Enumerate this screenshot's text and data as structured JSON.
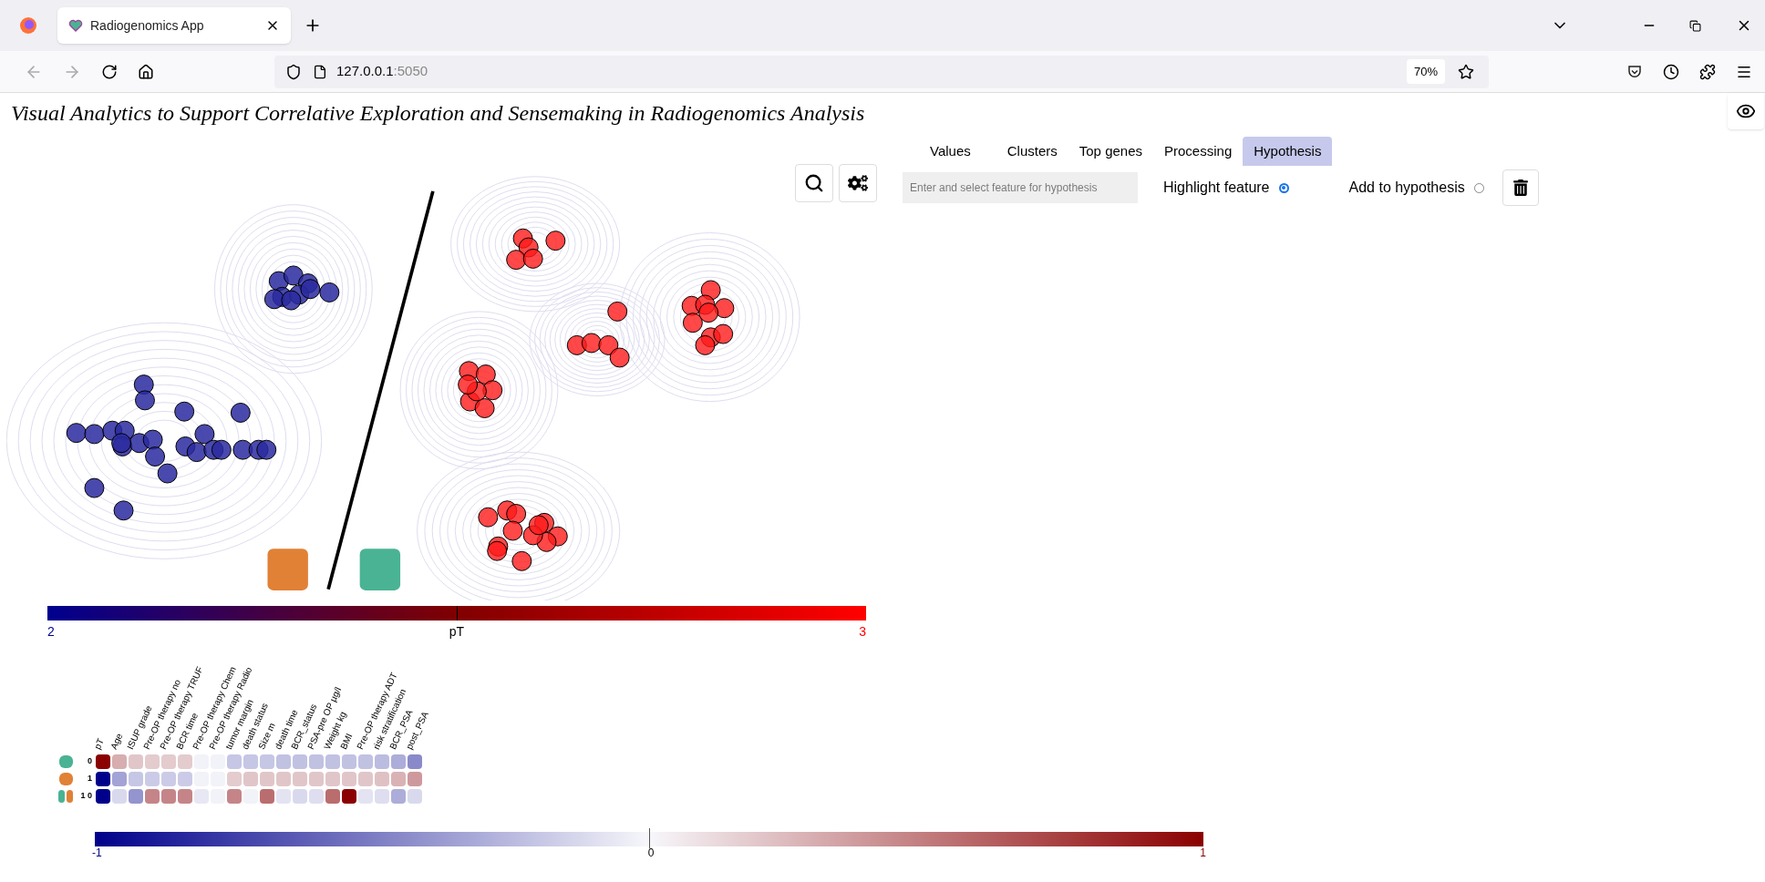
{
  "browser": {
    "tab_title": "Radiogenomics App",
    "url_host": "127.0.0.1",
    "url_port": ":5050",
    "zoom": "70%"
  },
  "page_title": "Visual Analytics to Support Correlative Exploration and Sensemaking in Radiogenomics Analysis",
  "tabs": [
    {
      "label": "Values",
      "selected": false
    },
    {
      "label": "Clusters",
      "selected": false
    },
    {
      "label": "Top genes",
      "selected": false
    },
    {
      "label": "Processing",
      "selected": false
    },
    {
      "label": "Hypothesis",
      "selected": true
    }
  ],
  "hypothesis": {
    "placeholder": "Enter and select feature for hypothesis",
    "options": [
      {
        "label": "Highlight feature",
        "selected": true
      },
      {
        "label": "Add to hypothesis",
        "selected": false
      }
    ]
  },
  "scatter": {
    "cluster_swatches": [
      {
        "color": "#e08136"
      },
      {
        "color": "#4ab394"
      }
    ]
  },
  "pt_colorbar": {
    "min": "2",
    "label": "pT",
    "max": "3"
  },
  "heatmap": {
    "columns": [
      "pT",
      "Age",
      "ISUP grade",
      "Pre-OP therapy no",
      "Pre-OP therapy TRUF",
      "BCR time",
      "Pre-OP therapy Chem",
      "Pre-OP therapy Radio",
      "tumor margin",
      "death status",
      "Size m",
      "death time",
      "BCR_status",
      "PSA-pre OP µg/l",
      "Weight kg",
      "BMI",
      "Pre-OP therapy ADT",
      "risk stratification",
      "BCR_PSA",
      "post_PSA"
    ],
    "rows": [
      {
        "label": "0",
        "clusters": [
          {
            "color": "#4ab394"
          }
        ],
        "cells": [
          {
            "color": "#8b0000"
          },
          {
            "color": "#d7adb0"
          },
          {
            "color": "#e1c6c9"
          },
          {
            "color": "#e4cbce"
          },
          {
            "color": "#e4cbce"
          },
          {
            "color": "#e4cbce"
          },
          {
            "color": "#f2f2f9"
          },
          {
            "color": "#f2f2f9"
          },
          {
            "color": "#c6c6e5"
          },
          {
            "color": "#c6c6e5"
          },
          {
            "color": "#c6c6e5"
          },
          {
            "color": "#c1c1e2"
          },
          {
            "color": "#c1c1e2"
          },
          {
            "color": "#c1c1e2"
          },
          {
            "color": "#c1c1e2"
          },
          {
            "color": "#c1c1e2"
          },
          {
            "color": "#c1c1e2"
          },
          {
            "color": "#bcbce0"
          },
          {
            "color": "#adadd9"
          },
          {
            "color": "#8a8aca"
          }
        ]
      },
      {
        "label": "1",
        "clusters": [
          {
            "color": "#e08136"
          }
        ],
        "cells": [
          {
            "color": "#00008b"
          },
          {
            "color": "#a3a3d5"
          },
          {
            "color": "#c6c6e5"
          },
          {
            "color": "#cbcbe7"
          },
          {
            "color": "#cbcbe7"
          },
          {
            "color": "#cbcbe7"
          },
          {
            "color": "#f2f2f9"
          },
          {
            "color": "#f2f2f9"
          },
          {
            "color": "#e4cbce"
          },
          {
            "color": "#e1c6c9"
          },
          {
            "color": "#e1c6c9"
          },
          {
            "color": "#e1c6c9"
          },
          {
            "color": "#e1c6c9"
          },
          {
            "color": "#e1c6c9"
          },
          {
            "color": "#e1c6c9"
          },
          {
            "color": "#e1c6c9"
          },
          {
            "color": "#e1c6c9"
          },
          {
            "color": "#dfc1c4"
          },
          {
            "color": "#d9b2b5"
          },
          {
            "color": "#ce999c"
          }
        ]
      },
      {
        "label": "1 0",
        "clusters": [
          {
            "color": "#4ab394"
          },
          {
            "color": "#e08136"
          }
        ],
        "cells": [
          {
            "color": "#00008b"
          },
          {
            "color": "#d9d9ee"
          },
          {
            "color": "#9494ce"
          },
          {
            "color": "#c58588"
          },
          {
            "color": "#c58588"
          },
          {
            "color": "#c58588"
          },
          {
            "color": "#e8e8f4"
          },
          {
            "color": "#f2f2f9"
          },
          {
            "color": "#c58588"
          },
          {
            "color": "#f2f2f9"
          },
          {
            "color": "#ba6d6e"
          },
          {
            "color": "#e3e3f2"
          },
          {
            "color": "#d9d9ee"
          },
          {
            "color": "#dedef0"
          },
          {
            "color": "#ba6d6e"
          },
          {
            "color": "#8b0000"
          },
          {
            "color": "#e3e3f2"
          },
          {
            "color": "#dedef0"
          },
          {
            "color": "#adadd9"
          },
          {
            "color": "#d9d9ee"
          }
        ]
      }
    ]
  },
  "legend": {
    "min": "-1",
    "mid": "0",
    "max": "1"
  }
}
